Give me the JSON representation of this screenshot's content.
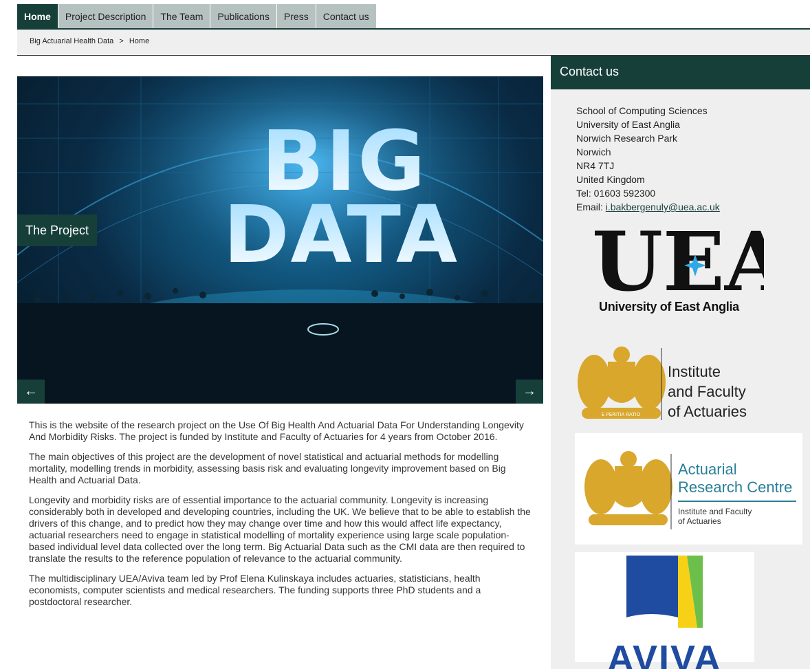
{
  "nav": {
    "items": [
      {
        "label": "Home",
        "active": true
      },
      {
        "label": "Project Description",
        "active": false
      },
      {
        "label": "The Team",
        "active": false
      },
      {
        "label": "Publications",
        "active": false
      },
      {
        "label": "Press",
        "active": false
      },
      {
        "label": "Contact us",
        "active": false
      }
    ]
  },
  "breadcrumb": {
    "items": [
      "Big Actuarial Health Data",
      "Home"
    ],
    "separator": ">"
  },
  "hero": {
    "caption": "The Project",
    "prev_arrow": "←",
    "next_arrow": "→",
    "image_text": [
      "BIG",
      "DATA"
    ]
  },
  "content": {
    "paragraphs": [
      "This is the website of the research project on the Use Of Big Health And Actuarial Data For Understanding Longevity And Morbidity Risks. The project is funded by Institute and Faculty of Actuaries for 4 years from October 2016.",
      "The main objectives of this project are the development of novel statistical and actuarial methods for modelling mortality, modelling trends in morbidity, assessing basis risk and evaluating longevity improvement based on Big Health and Actuarial Data.",
      "Longevity and morbidity risks are of essential importance to the actuarial community. Longevity is increasing considerably both in developed and developing countries, including the UK. We believe that to be able to establish the drivers of this change, and to predict how they may change over time and how this would affect life expectancy, actuarial researchers need to engage in statistical modelling of mortality experience using large scale population-based individual level data collected over the long term. Big Actuarial Data such as the CMI data are then required to translate the results to the reference population of relevance to the actuarial community.",
      "The multidisciplinary UEA/Aviva team led by Prof Elena Kulinskaya includes actuaries, statisticians, health economists, computer scientists and medical researchers. The funding supports three PhD students and a postdoctoral researcher."
    ]
  },
  "sidebar": {
    "title": "Contact us",
    "address": [
      "School of Computing Sciences",
      "University of East Anglia",
      "Norwich Research Park",
      "Norwich",
      "NR4 7TJ",
      "United Kingdom",
      "Tel: 01603 592300"
    ],
    "email_label": "Email: ",
    "email": "i.bakbergenuly@uea.ac.uk",
    "logos": {
      "uea": {
        "letters": "UEA",
        "name": "University of East Anglia"
      },
      "ifoa": {
        "lines": [
          "Institute",
          "and Faculty",
          "of Actuaries"
        ],
        "motto": "E PERITIA RATIO"
      },
      "arc": {
        "lines": [
          "Actuarial",
          "Research Centre"
        ],
        "sub": [
          "Institute and Faculty",
          "of Actuaries"
        ]
      },
      "aviva": {
        "name": "AVIVA"
      }
    }
  },
  "colors": {
    "brand": "#173f3a",
    "nav_inactive": "#b6c2c0",
    "sidebar_bg": "#efefef",
    "gold": "#d8a72c",
    "arc_teal": "#2a7f98",
    "aviva_blue": "#1f4ba0",
    "aviva_yellow": "#f7d117",
    "aviva_green": "#6dbf4b"
  }
}
